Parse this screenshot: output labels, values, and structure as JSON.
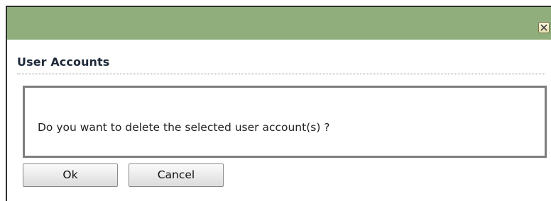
{
  "dialog": {
    "section_title": "User Accounts",
    "message": "Do you want to delete the selected user account(s) ?",
    "close_icon": "close-icon",
    "buttons": {
      "ok_label": "Ok",
      "cancel_label": "Cancel"
    },
    "colors": {
      "titlebar": "#8fae7b",
      "close_button": "#f3ecc6"
    }
  }
}
